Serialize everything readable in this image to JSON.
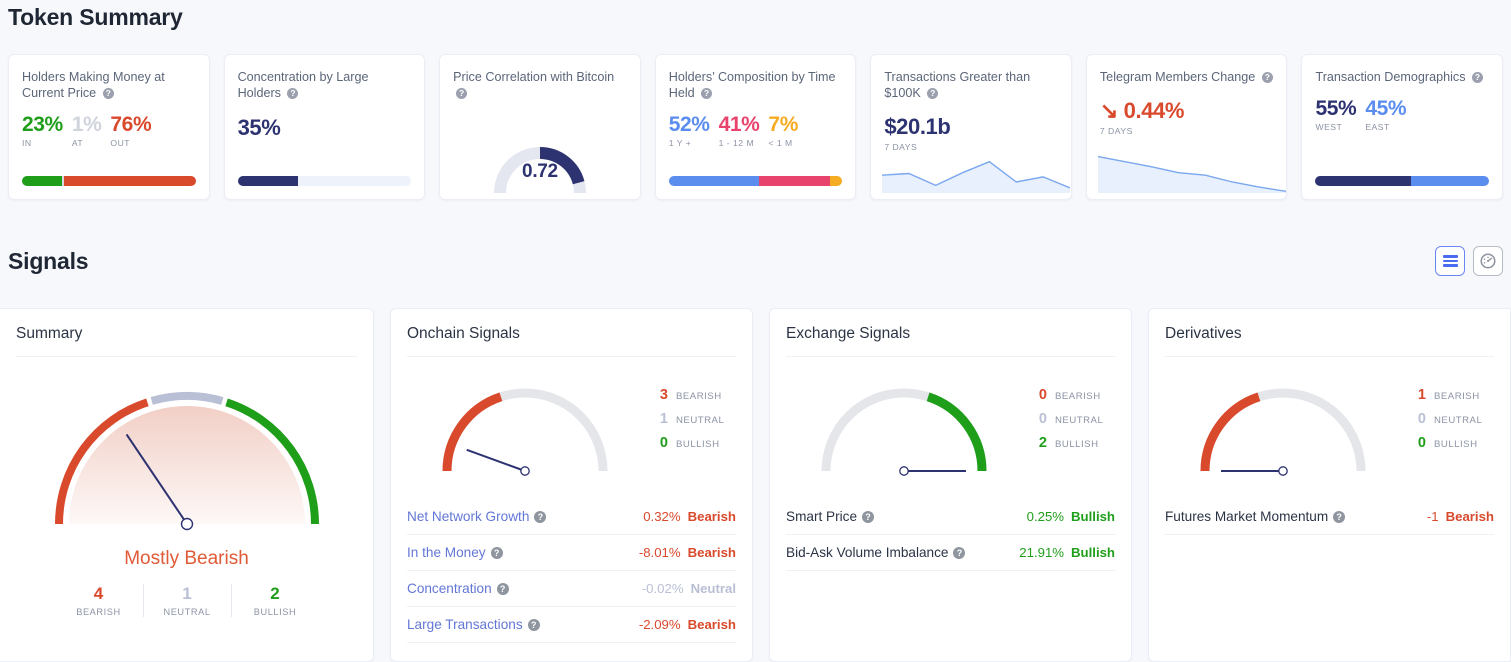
{
  "sections": {
    "token_summary_title": "Token Summary",
    "signals_title": "Signals"
  },
  "colors": {
    "bullish": "#1f9e1a",
    "bearish": "#d9492c",
    "neutral": "#b9bfd4",
    "navy": "#2d3270",
    "blue": "#5b8def",
    "pink": "#e8436d",
    "amber": "#f5ac22",
    "link": "#6377d6",
    "background": "#f7f8fc"
  },
  "token_summary": {
    "cards": [
      {
        "title": "Holders Making Money at Current Price",
        "type": "multi-stat",
        "stats": [
          {
            "value": "23%",
            "label": "IN",
            "color": "#1f9e1a"
          },
          {
            "value": "1%",
            "label": "AT",
            "color": "#cfd3dc"
          },
          {
            "value": "76%",
            "label": "OUT",
            "color": "#d9492c"
          }
        ],
        "bar": [
          {
            "pct": 23,
            "color": "#1f9e1a"
          },
          {
            "pct": 1,
            "color": "#d7dae2"
          },
          {
            "pct": 76,
            "color": "#d9492c"
          }
        ]
      },
      {
        "title": "Concentration by Large Holders",
        "type": "single-stat",
        "value": "35%",
        "bar": [
          {
            "pct": 35,
            "color": "#2d3270"
          },
          {
            "pct": 65,
            "color": "#eef3fb"
          }
        ]
      },
      {
        "title": "Price Correlation with Bitcoin",
        "type": "donut",
        "value": "0.72",
        "gauge_fraction": 0.45,
        "gauge_color": "#2d3270",
        "track_color": "#e4e6f0"
      },
      {
        "title": "Holders’ Composition by Time Held",
        "type": "multi-stat",
        "stats": [
          {
            "value": "52%",
            "label": "1 Y +",
            "color": "#5b8def"
          },
          {
            "value": "41%",
            "label": "1 - 12 M",
            "color": "#e8436d"
          },
          {
            "value": "7%",
            "label": "< 1 M",
            "color": "#f5ac22"
          }
        ],
        "bar": [
          {
            "pct": 52,
            "color": "#5b8def"
          },
          {
            "pct": 41,
            "color": "#e8436d"
          },
          {
            "pct": 7,
            "color": "#f5ac22"
          }
        ]
      },
      {
        "title": "Transactions Greater than $100K",
        "type": "sparkline",
        "value": "$20.1b",
        "period": "7 DAYS",
        "points": [
          62,
          58,
          86,
          56,
          30,
          78,
          66,
          92
        ]
      },
      {
        "title": "Telegram Members Change",
        "type": "sparkline-trend",
        "value": "0.44%",
        "trend_icon": "arrow-down-right",
        "value_color": "#d9492c",
        "period": "7 DAYS",
        "points": [
          18,
          30,
          42,
          56,
          62,
          78,
          90,
          100
        ]
      },
      {
        "title": "Transaction Demographics",
        "type": "multi-stat",
        "stats": [
          {
            "value": "55%",
            "label": "WEST",
            "color": "#2d3270"
          },
          {
            "value": "45%",
            "label": "EAST",
            "color": "#5b8def"
          }
        ],
        "bar": [
          {
            "pct": 55,
            "color": "#2d3270"
          },
          {
            "pct": 45,
            "color": "#5b8def"
          }
        ]
      }
    ]
  },
  "toggles": {
    "list_view": "list-view-icon",
    "gauge_view": "gauge-view-icon",
    "active": "list_view"
  },
  "summary_panel": {
    "heading": "Summary",
    "verdict": "Mostly Bearish",
    "needle_angle_deg": 56,
    "stats": [
      {
        "num": "4",
        "label": "BEARISH",
        "color": "#d9492c"
      },
      {
        "num": "1",
        "label": "NEUTRAL",
        "color": "#b9bfd4"
      },
      {
        "num": "2",
        "label": "BULLISH",
        "color": "#1f9e1a"
      }
    ]
  },
  "signal_panels": [
    {
      "heading": "Onchain Signals",
      "counts": [
        {
          "num": "3",
          "label": "BEARISH",
          "color": "#d9492c"
        },
        {
          "num": "1",
          "label": "NEUTRAL",
          "color": "#b9bfd4"
        },
        {
          "num": "0",
          "label": "BULLISH",
          "color": "#1f9e1a"
        }
      ],
      "gauge": {
        "bearish_pct": 0.4,
        "neutral_pct": 0.0,
        "bullish_pct": 0.0,
        "needle_deg": 200
      },
      "link_style": true,
      "rows": [
        {
          "name": "Net Network Growth",
          "pct": "0.32%",
          "verdict": "Bearish",
          "color": "#d9492c"
        },
        {
          "name": "In the Money",
          "pct": "-8.01%",
          "verdict": "Bearish",
          "color": "#d9492c"
        },
        {
          "name": "Concentration",
          "pct": "-0.02%",
          "verdict": "Neutral",
          "color": "#b9bfd4"
        },
        {
          "name": "Large Transactions",
          "pct": "-2.09%",
          "verdict": "Bearish",
          "color": "#d9492c"
        }
      ]
    },
    {
      "heading": "Exchange Signals",
      "counts": [
        {
          "num": "0",
          "label": "BEARISH",
          "color": "#d9492c"
        },
        {
          "num": "0",
          "label": "NEUTRAL",
          "color": "#b9bfd4"
        },
        {
          "num": "2",
          "label": "BULLISH",
          "color": "#1f9e1a"
        }
      ],
      "gauge": {
        "bearish_pct": 0.0,
        "neutral_pct": 0.0,
        "bullish_pct": 0.4,
        "needle_deg": 0
      },
      "link_style": false,
      "rows": [
        {
          "name": "Smart Price",
          "pct": "0.25%",
          "verdict": "Bullish",
          "color": "#1f9e1a"
        },
        {
          "name": "Bid-Ask Volume Imbalance",
          "pct": "21.91%",
          "verdict": "Bullish",
          "color": "#1f9e1a"
        }
      ]
    },
    {
      "heading": "Derivatives",
      "counts": [
        {
          "num": "1",
          "label": "BEARISH",
          "color": "#d9492c"
        },
        {
          "num": "0",
          "label": "NEUTRAL",
          "color": "#b9bfd4"
        },
        {
          "num": "0",
          "label": "BULLISH",
          "color": "#1f9e1a"
        }
      ],
      "gauge": {
        "bearish_pct": 0.4,
        "neutral_pct": 0.0,
        "bullish_pct": 0.0,
        "needle_deg": 180
      },
      "link_style": false,
      "rows": [
        {
          "name": "Futures Market Momentum",
          "pct": "-1",
          "verdict": "Bearish",
          "color": "#d9492c"
        }
      ]
    }
  ]
}
